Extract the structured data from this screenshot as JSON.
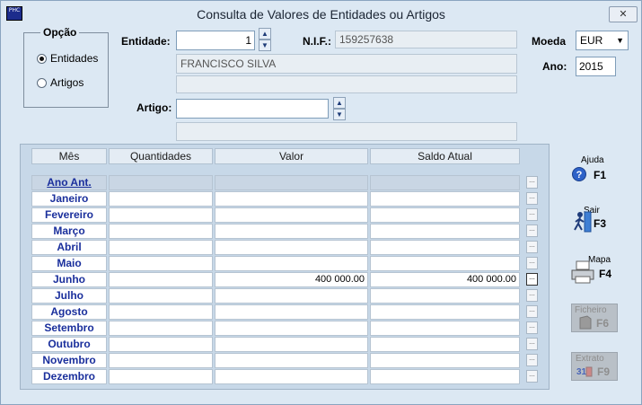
{
  "window": {
    "title": "Consulta de Valores de Entidades ou Artigos",
    "icon_text": "PHC",
    "close_label": "✕"
  },
  "opcao": {
    "title": "Opção",
    "options": [
      {
        "label": "Entidades",
        "selected": true
      },
      {
        "label": "Artigos",
        "selected": false
      }
    ]
  },
  "entidade": {
    "label": "Entidade:",
    "value": "1",
    "name": "FRANCISCO SILVA",
    "extra": ""
  },
  "nif": {
    "label": "N.I.F.:",
    "value": "159257638"
  },
  "moeda": {
    "label": "Moeda",
    "value": "EUR"
  },
  "ano": {
    "label": "Ano:",
    "value": "2015"
  },
  "artigo": {
    "label": "Artigo:",
    "value": "",
    "description": ""
  },
  "grid": {
    "columns": [
      "Mês",
      "Quantidades",
      "Valor",
      "Saldo Atual"
    ],
    "rows": [
      {
        "mes": "Ano Ant.",
        "quantidades": "",
        "valor": "",
        "saldo": ""
      },
      {
        "mes": "Janeiro",
        "quantidades": "",
        "valor": "",
        "saldo": ""
      },
      {
        "mes": "Fevereiro",
        "quantidades": "",
        "valor": "",
        "saldo": ""
      },
      {
        "mes": "Março",
        "quantidades": "",
        "valor": "",
        "saldo": ""
      },
      {
        "mes": "Abril",
        "quantidades": "",
        "valor": "",
        "saldo": ""
      },
      {
        "mes": "Maio",
        "quantidades": "",
        "valor": "",
        "saldo": ""
      },
      {
        "mes": "Junho",
        "quantidades": "",
        "valor": "400 000.00",
        "saldo": "400 000.00"
      },
      {
        "mes": "Julho",
        "quantidades": "",
        "valor": "",
        "saldo": ""
      },
      {
        "mes": "Agosto",
        "quantidades": "",
        "valor": "",
        "saldo": ""
      },
      {
        "mes": "Setembro",
        "quantidades": "",
        "valor": "",
        "saldo": ""
      },
      {
        "mes": "Outubro",
        "quantidades": "",
        "valor": "",
        "saldo": ""
      },
      {
        "mes": "Novembro",
        "quantidades": "",
        "valor": "",
        "saldo": ""
      },
      {
        "mes": "Dezembro",
        "quantidades": "",
        "valor": "",
        "saldo": ""
      }
    ],
    "row_button_label": "..."
  },
  "actions": [
    {
      "label": "Ajuda",
      "key": "F1",
      "icon": "help-icon",
      "enabled": true
    },
    {
      "label": "Sair",
      "key": "F3",
      "icon": "exit-icon",
      "enabled": true
    },
    {
      "label": "Mapa",
      "key": "F4",
      "icon": "printer-icon",
      "enabled": true
    },
    {
      "label": "Ficheiro",
      "key": "F6",
      "icon": "file-icon",
      "enabled": false
    },
    {
      "label": "Extrato",
      "key": "F9",
      "icon": "statement-icon",
      "enabled": false
    }
  ]
}
